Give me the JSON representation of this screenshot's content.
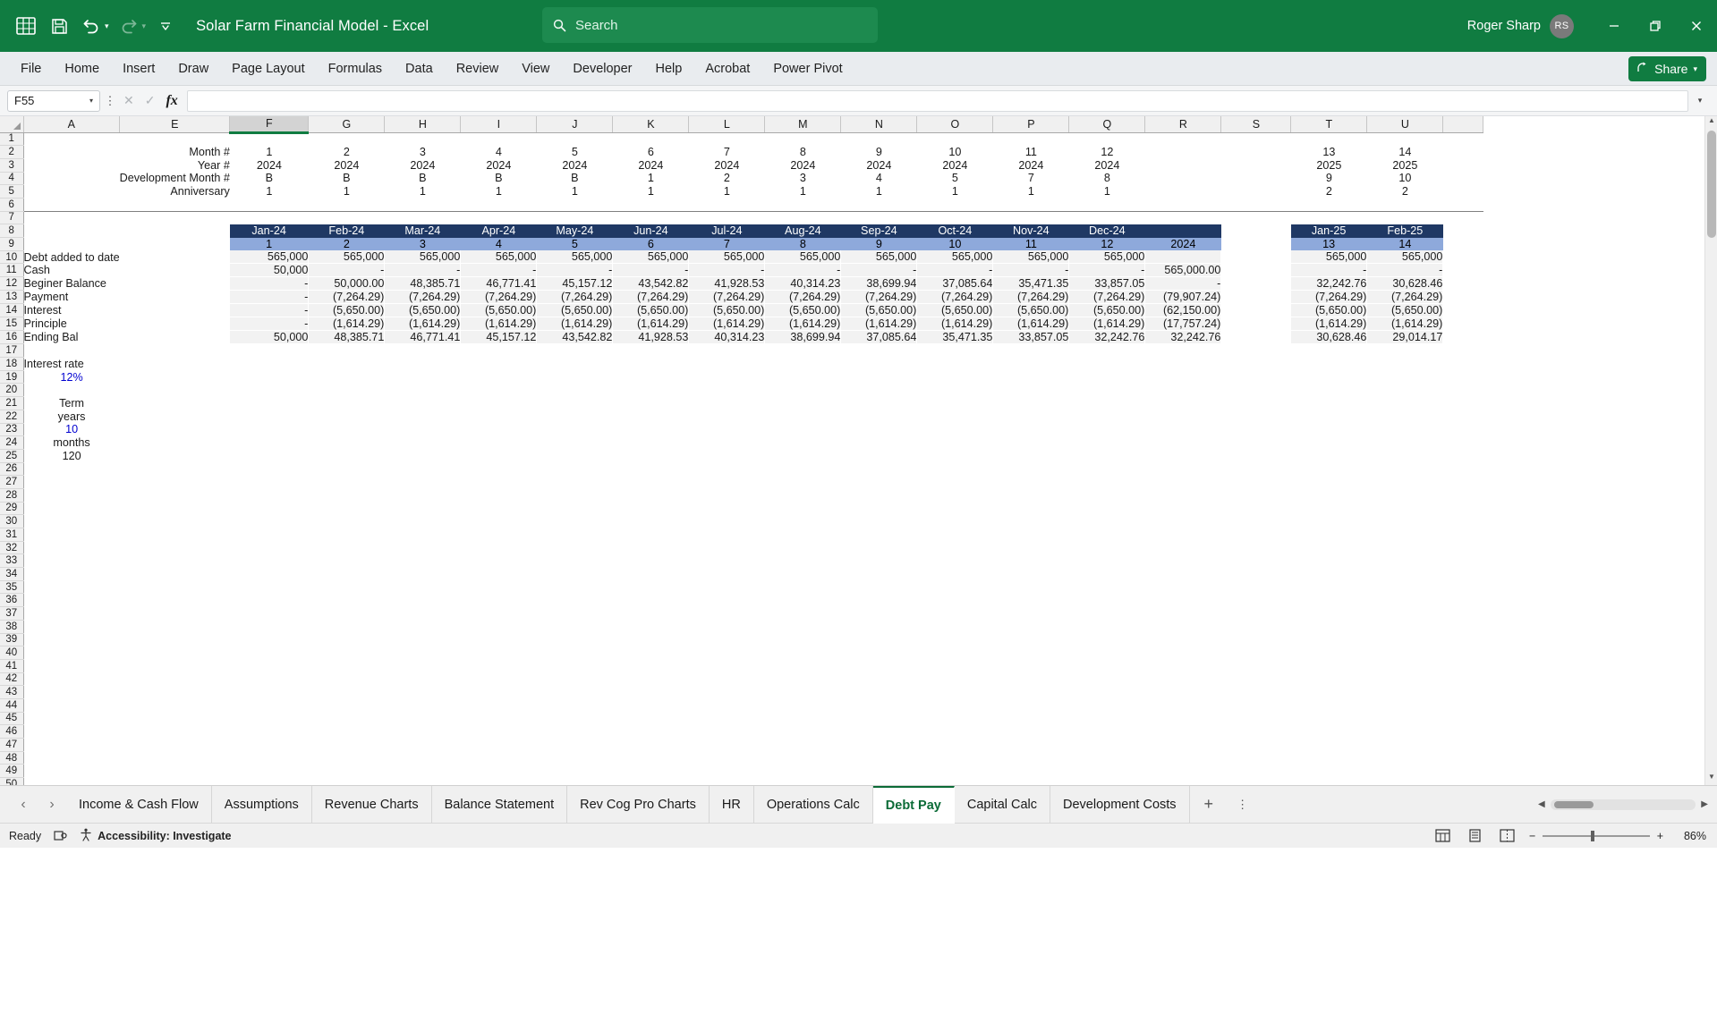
{
  "titlebar": {
    "app_title": "Solar Farm Financial Model  -  Excel",
    "icons": [
      "excel-icon",
      "save-icon",
      "undo-icon",
      "redo-icon",
      "customize-quick-access-icon"
    ],
    "search_placeholder": "Search",
    "user_name": "Roger Sharp",
    "user_initials": "RS"
  },
  "ribbon": {
    "tabs": [
      "File",
      "Home",
      "Insert",
      "Draw",
      "Page Layout",
      "Formulas",
      "Data",
      "Review",
      "View",
      "Developer",
      "Help",
      "Acrobat",
      "Power Pivot"
    ],
    "share_label": "Share"
  },
  "formula_bar": {
    "name_box": "F55",
    "formula": ""
  },
  "grid": {
    "columns": [
      "A",
      "E",
      "F",
      "G",
      "H",
      "I",
      "J",
      "K",
      "L",
      "M",
      "N",
      "O",
      "P",
      "Q",
      "R",
      "S",
      "T",
      "U"
    ],
    "selected_column": "F",
    "row_numbers": [
      1,
      2,
      3,
      4,
      5,
      6,
      7,
      8,
      9,
      10,
      11,
      12,
      13,
      14,
      15,
      16,
      17,
      18,
      19,
      20,
      21,
      22,
      23,
      24,
      25,
      26,
      27,
      28,
      29,
      30,
      31,
      32,
      33,
      34,
      35,
      36,
      37,
      38,
      39,
      40,
      41,
      42,
      43,
      44,
      45,
      46,
      47,
      48,
      49,
      50
    ],
    "top_block": {
      "labels": [
        "Month #",
        "Year #",
        "Development Month #",
        "Anniversary"
      ],
      "rows": [
        {
          "label": "Month #",
          "values": [
            "1",
            "2",
            "3",
            "4",
            "5",
            "6",
            "7",
            "8",
            "9",
            "10",
            "11",
            "12",
            "",
            "13",
            "14"
          ]
        },
        {
          "label": "Year #",
          "values": [
            "2024",
            "2024",
            "2024",
            "2024",
            "2024",
            "2024",
            "2024",
            "2024",
            "2024",
            "2024",
            "2024",
            "2024",
            "",
            "2025",
            "2025"
          ]
        },
        {
          "label": "Development Month #",
          "values": [
            "B",
            "B",
            "B",
            "B",
            "B",
            "1",
            "2",
            "3",
            "4",
            "5",
            "7",
            "8",
            "",
            "9",
            "10"
          ]
        },
        {
          "label": "Anniversary",
          "values": [
            "1",
            "1",
            "1",
            "1",
            "1",
            "1",
            "1",
            "1",
            "1",
            "1",
            "1",
            "1",
            "",
            "2",
            "2"
          ]
        }
      ]
    },
    "table": {
      "month_headers": [
        "Jan-24",
        "Feb-24",
        "Mar-24",
        "Apr-24",
        "May-24",
        "Jun-24",
        "Jul-24",
        "Aug-24",
        "Sep-24",
        "Oct-24",
        "Nov-24",
        "Dec-24",
        ""
      ],
      "period_numbers": [
        "1",
        "2",
        "3",
        "4",
        "5",
        "6",
        "7",
        "8",
        "9",
        "10",
        "11",
        "12",
        "2024"
      ],
      "month_headers_right": [
        "Jan-25",
        "Feb-25"
      ],
      "period_numbers_right": [
        "13",
        "14"
      ],
      "rows": [
        {
          "label": "Debt added to date",
          "values": [
            "565,000",
            "565,000",
            "565,000",
            "565,000",
            "565,000",
            "565,000",
            "565,000",
            "565,000",
            "565,000",
            "565,000",
            "565,000",
            "565,000",
            ""
          ],
          "values_right": [
            "565,000",
            "565,000"
          ]
        },
        {
          "label": "Cash",
          "values": [
            "50,000",
            "-",
            "-",
            "-",
            "-",
            "-",
            "-",
            "-",
            "-",
            "-",
            "-",
            "-",
            "565,000.00"
          ],
          "values_right": [
            "-",
            "-"
          ]
        },
        {
          "label": "Beginer Balance",
          "values": [
            "-",
            "50,000.00",
            "48,385.71",
            "46,771.41",
            "45,157.12",
            "43,542.82",
            "41,928.53",
            "40,314.23",
            "38,699.94",
            "37,085.64",
            "35,471.35",
            "33,857.05",
            "-"
          ],
          "values_right": [
            "32,242.76",
            "30,628.46"
          ]
        },
        {
          "label": "Payment",
          "values": [
            "-",
            "(7,264.29)",
            "(7,264.29)",
            "(7,264.29)",
            "(7,264.29)",
            "(7,264.29)",
            "(7,264.29)",
            "(7,264.29)",
            "(7,264.29)",
            "(7,264.29)",
            "(7,264.29)",
            "(7,264.29)",
            "(79,907.24)"
          ],
          "values_right": [
            "(7,264.29)",
            "(7,264.29)"
          ]
        },
        {
          "label": "Interest",
          "values": [
            "-",
            "(5,650.00)",
            "(5,650.00)",
            "(5,650.00)",
            "(5,650.00)",
            "(5,650.00)",
            "(5,650.00)",
            "(5,650.00)",
            "(5,650.00)",
            "(5,650.00)",
            "(5,650.00)",
            "(5,650.00)",
            "(62,150.00)"
          ],
          "values_right": [
            "(5,650.00)",
            "(5,650.00)"
          ]
        },
        {
          "label": "Principle",
          "values": [
            "-",
            "(1,614.29)",
            "(1,614.29)",
            "(1,614.29)",
            "(1,614.29)",
            "(1,614.29)",
            "(1,614.29)",
            "(1,614.29)",
            "(1,614.29)",
            "(1,614.29)",
            "(1,614.29)",
            "(1,614.29)",
            "(17,757.24)"
          ],
          "values_right": [
            "(1,614.29)",
            "(1,614.29)"
          ]
        },
        {
          "label": "Ending Bal",
          "values": [
            "50,000",
            "48,385.71",
            "46,771.41",
            "45,157.12",
            "43,542.82",
            "41,928.53",
            "40,314.23",
            "38,699.94",
            "37,085.64",
            "35,471.35",
            "33,857.05",
            "32,242.76",
            "32,242.76"
          ],
          "values_right": [
            "30,628.46",
            "29,014.17"
          ]
        }
      ]
    },
    "assumptions": {
      "interest_rate_label": "Interest rate",
      "interest_rate_value": "12%",
      "term_label": "Term",
      "years_label": "years",
      "years_value": "10",
      "months_label": "months",
      "months_value": "120"
    }
  },
  "sheet_tabs": {
    "tabs": [
      "Income & Cash Flow",
      "Assumptions",
      "Revenue Charts",
      "Balance Statement",
      "Rev Cog Pro Charts",
      "HR",
      "Operations Calc",
      "Debt Pay",
      "Capital Calc",
      "Development Costs"
    ],
    "active": "Debt Pay",
    "add_label": "+"
  },
  "status_bar": {
    "state": "Ready",
    "accessibility": "Accessibility: Investigate",
    "zoom": "86%"
  },
  "colors": {
    "brand_green": "#107C41",
    "header_dark": "#1F3864",
    "header_light": "#8EA9DB",
    "input_blue": "#0000D0"
  }
}
